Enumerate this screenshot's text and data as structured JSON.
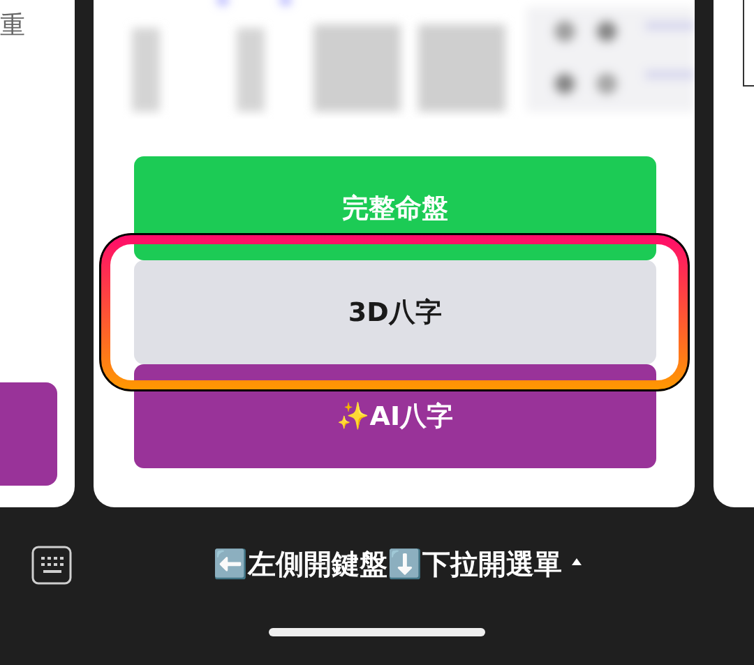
{
  "left_card": {
    "text": "重"
  },
  "main_card": {
    "buttons": [
      {
        "label": "完整命盤",
        "color": "#1ccb55",
        "highlighted": false
      },
      {
        "label": "3D八字",
        "color": "#dfe0e6",
        "highlighted": true
      },
      {
        "label": "✨AI八字",
        "color": "#993399",
        "highlighted": false
      }
    ]
  },
  "bottom_bar": {
    "hint": "⬅️左側開鍵盤⬇️下拉開選單"
  }
}
